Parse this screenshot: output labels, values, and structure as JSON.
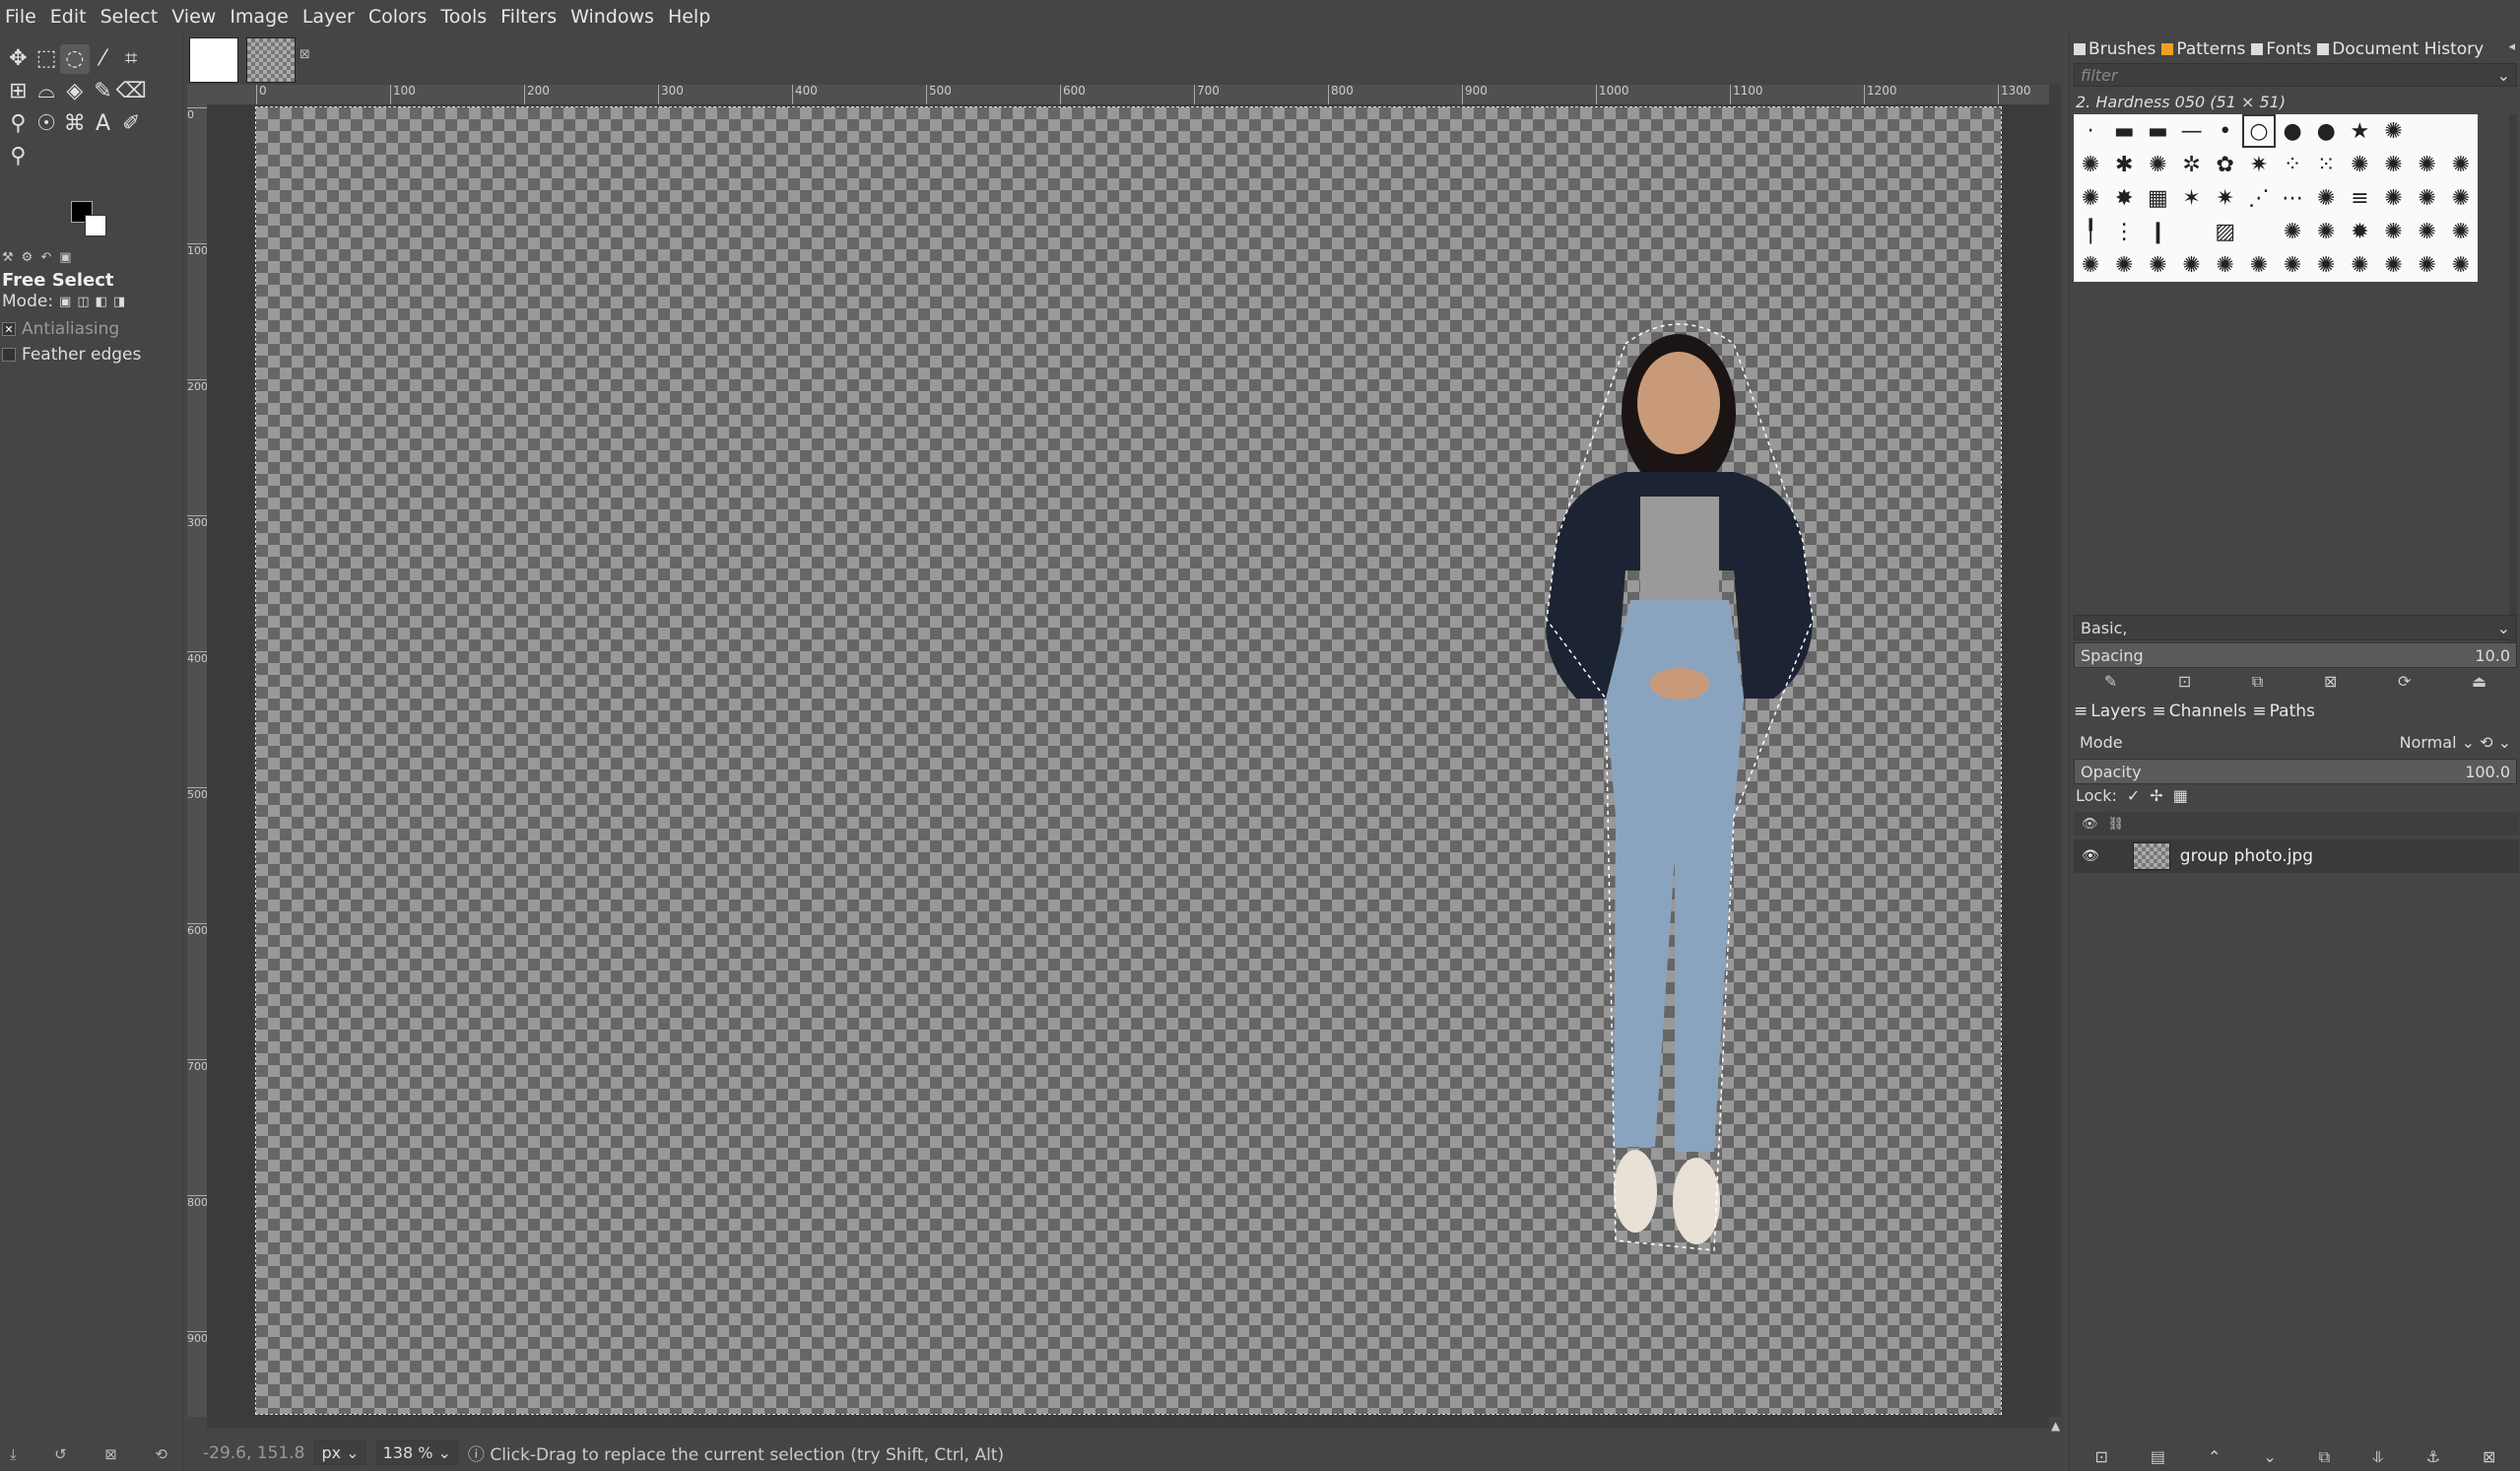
{
  "menubar": {
    "items": [
      "File",
      "Edit",
      "Select",
      "View",
      "Image",
      "Layer",
      "Colors",
      "Tools",
      "Filters",
      "Windows",
      "Help"
    ]
  },
  "toolbox": {
    "tools": [
      {
        "name": "move-tool-icon",
        "glyph": "✥"
      },
      {
        "name": "rect-select-icon",
        "glyph": "⬚"
      },
      {
        "name": "free-select-icon",
        "glyph": "◌",
        "active": true
      },
      {
        "name": "fuzzy-select-icon",
        "glyph": "⁄"
      },
      {
        "name": "crop-icon",
        "glyph": "⌗"
      },
      {
        "name": "unified-transform-icon",
        "glyph": "⊞"
      },
      {
        "name": "warp-transform-icon",
        "glyph": "⌓"
      },
      {
        "name": "bucket-fill-icon",
        "glyph": "◈"
      },
      {
        "name": "paintbrush-icon",
        "glyph": "✎"
      },
      {
        "name": "eraser-icon",
        "glyph": "⌫"
      },
      {
        "name": "clone-icon",
        "glyph": "⚲"
      },
      {
        "name": "smudge-icon",
        "glyph": "☉"
      },
      {
        "name": "paths-icon",
        "glyph": "⌘"
      },
      {
        "name": "text-icon",
        "glyph": "A"
      },
      {
        "name": "color-picker-icon",
        "glyph": "✐"
      },
      {
        "name": "zoom-icon",
        "glyph": "⚲"
      }
    ],
    "options_title": "Free Select",
    "mode_label": "Mode:",
    "antialiasing_label": "Antialiasing",
    "feather_label": "Feather edges"
  },
  "statusbar": {
    "coords": "-29.6, 151.8",
    "unit": "px",
    "zoom": "138 %",
    "message": "Click-Drag to replace the current selection (try Shift, Ctrl, Alt)"
  },
  "dock": {
    "tabs_top": [
      {
        "label": "Brushes",
        "color": "#dddddd"
      },
      {
        "label": "Patterns",
        "color": "#f0a020"
      },
      {
        "label": "Fonts",
        "color": "#dddddd"
      },
      {
        "label": "Document History",
        "color": "#dddddd"
      }
    ],
    "filter_placeholder": "filter",
    "brush_name": "2. Hardness 050 (51 × 51)",
    "brush_glyphs": [
      "·",
      "▬",
      "▬",
      "—",
      "•",
      "○",
      "●",
      "●",
      "★",
      "✺",
      "",
      "",
      "✺",
      "✱",
      "✺",
      "✲",
      "✿",
      "✷",
      "⁘",
      "⁙",
      "✺",
      "✺",
      "✺",
      "✺",
      "✺",
      "✸",
      "▦",
      "✶",
      "✷",
      "⋰",
      "⋯",
      "✺",
      "≡",
      "✺",
      "✺",
      "✺",
      "╿",
      "⋮",
      "❙",
      "",
      "▨",
      "",
      "✺",
      "✺",
      "✹",
      "✺",
      "✺",
      "✺",
      "✺",
      "✺",
      "✺",
      "✺",
      "✺",
      "✺",
      "✺",
      "✺",
      "✺",
      "✺",
      "✺",
      "✺"
    ],
    "tag_value": "Basic,",
    "spacing_label": "Spacing",
    "spacing_value": "10.0",
    "tabs_bottom": [
      "Layers",
      "Channels",
      "Paths"
    ],
    "mode_label": "Mode",
    "mode_value": "Normal",
    "opacity_label": "Opacity",
    "opacity_value": "100.0",
    "lock_label": "Lock:",
    "layer_name": "group photo.jpg"
  },
  "rulers": {
    "h_labels": [
      "0",
      "100",
      "200",
      "300",
      "400",
      "500",
      "600",
      "700",
      "800",
      "900",
      "1000",
      "1100",
      "1200",
      "1300"
    ],
    "v_labels": [
      "0",
      "100",
      "200",
      "300",
      "400",
      "500",
      "600",
      "700",
      "800",
      "900"
    ]
  }
}
